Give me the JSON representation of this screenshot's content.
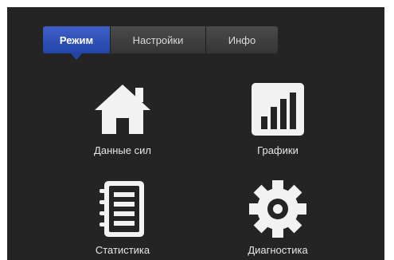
{
  "tabs": {
    "mode": "Режим",
    "settings": "Настройки",
    "info": "Инфо"
  },
  "tiles": {
    "data": {
      "label": "Данные сил",
      "icon": "home-icon"
    },
    "charts": {
      "label": "Графики",
      "icon": "bar-chart-icon"
    },
    "statistics": {
      "label": "Статистика",
      "icon": "notebook-icon"
    },
    "diagnostics": {
      "label": "Диагностика",
      "icon": "gear-icon"
    }
  },
  "colors": {
    "background": "#242424",
    "tab_active": "#2245a8",
    "tab_inactive": "#3f3f3f",
    "icon": "#f2f2f2"
  }
}
